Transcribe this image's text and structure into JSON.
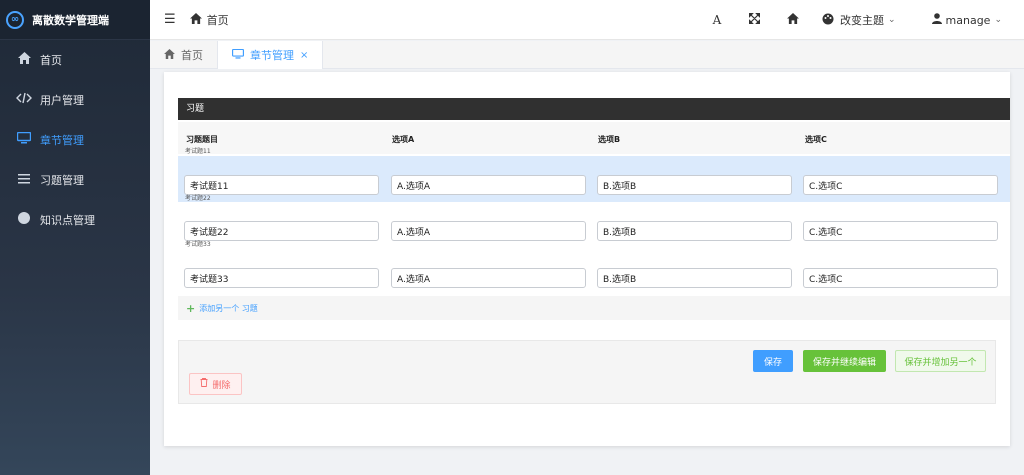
{
  "app": {
    "title": "离散数学管理端",
    "logo_glyph": "∞"
  },
  "sidebar": {
    "items": [
      {
        "label": "首页",
        "icon": "home-icon"
      },
      {
        "label": "用户管理",
        "icon": "code-icon"
      },
      {
        "label": "章节管理",
        "icon": "monitor-icon",
        "active": true
      },
      {
        "label": "习题管理",
        "icon": "list-icon"
      },
      {
        "label": "知识点管理",
        "icon": "circle-icon"
      }
    ]
  },
  "header": {
    "breadcrumb": "首页",
    "theme_label": "改变主题",
    "user_label": "manage",
    "font_icon_glyph": "A"
  },
  "tabs": [
    {
      "label": "首页",
      "active": false
    },
    {
      "label": "章节管理",
      "active": true,
      "close": "×"
    }
  ],
  "form": {
    "inline_title": "习题",
    "columns": [
      "习题题目",
      "选项A",
      "选项B",
      "选项C"
    ],
    "rows": [
      {
        "caption": "考试题11",
        "question": "考试题11",
        "a": "A.选项A",
        "b": "B.选项B",
        "c": "C.选项C"
      },
      {
        "caption": "考试题22",
        "question": "考试题22",
        "a": "A.选项A",
        "b": "B.选项B",
        "c": "C.选项C"
      },
      {
        "caption": "考试题33",
        "question": "考试题33",
        "a": "A.选项A",
        "b": "B.选项B",
        "c": "C.选项C"
      }
    ],
    "add_another": "添加另一个 习题",
    "buttons": {
      "save": "保存",
      "save_continue": "保存并继续编辑",
      "save_another": "保存并增加另一个",
      "delete": "删除"
    }
  },
  "colors": {
    "accent": "#409eff",
    "success": "#67c23a",
    "danger": "#f56c6c",
    "sidebar": "#1f2937"
  }
}
